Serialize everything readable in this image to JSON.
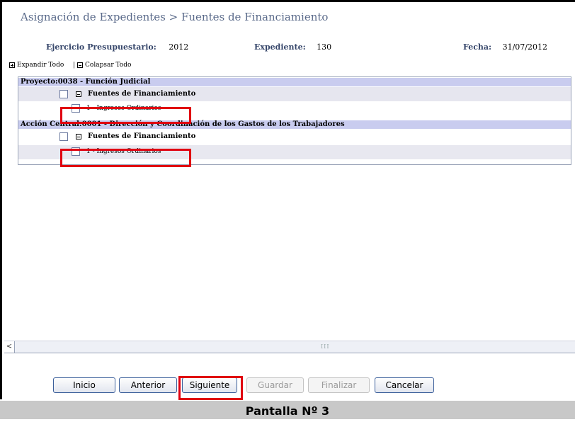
{
  "title": "Asignación de Expedientes > Fuentes de Financiamiento",
  "header": {
    "ejercicio_label": "Ejercicio Presupuestario:",
    "ejercicio_value": "2012",
    "expediente_label": "Expediente:",
    "expediente_value": "130",
    "fecha_label": "Fecha:",
    "fecha_value": "31/07/2012"
  },
  "tree_controls": {
    "expand_label": "Expandir Todo",
    "separator": "|",
    "collapse_label": "Colapsar Todo"
  },
  "tree": [
    {
      "header": "Proyecto:0038 - Función Judicial",
      "group": "Fuentes de Financiamiento",
      "item": "1 - Ingresos Ordinarios"
    },
    {
      "header": "Acción Central:0001 - Dirección y Coordinación de los Gastos de los Trabajadores",
      "group": "Fuentes de Financiamiento",
      "item": "1 - Ingresos Ordinarios"
    }
  ],
  "scrollbar": {
    "left_arrow": "<",
    "grip": "III"
  },
  "buttons": {
    "inicio": "Inicio",
    "anterior": "Anterior",
    "siguiente": "Siguiente",
    "guardar": "Guardar",
    "finalizar": "Finalizar",
    "cancelar": "Cancelar"
  },
  "caption": "Pantalla Nº 3",
  "colors": {
    "highlight": "#e00010",
    "project_row": "#c9ccef",
    "title": "#5a6a8a"
  }
}
